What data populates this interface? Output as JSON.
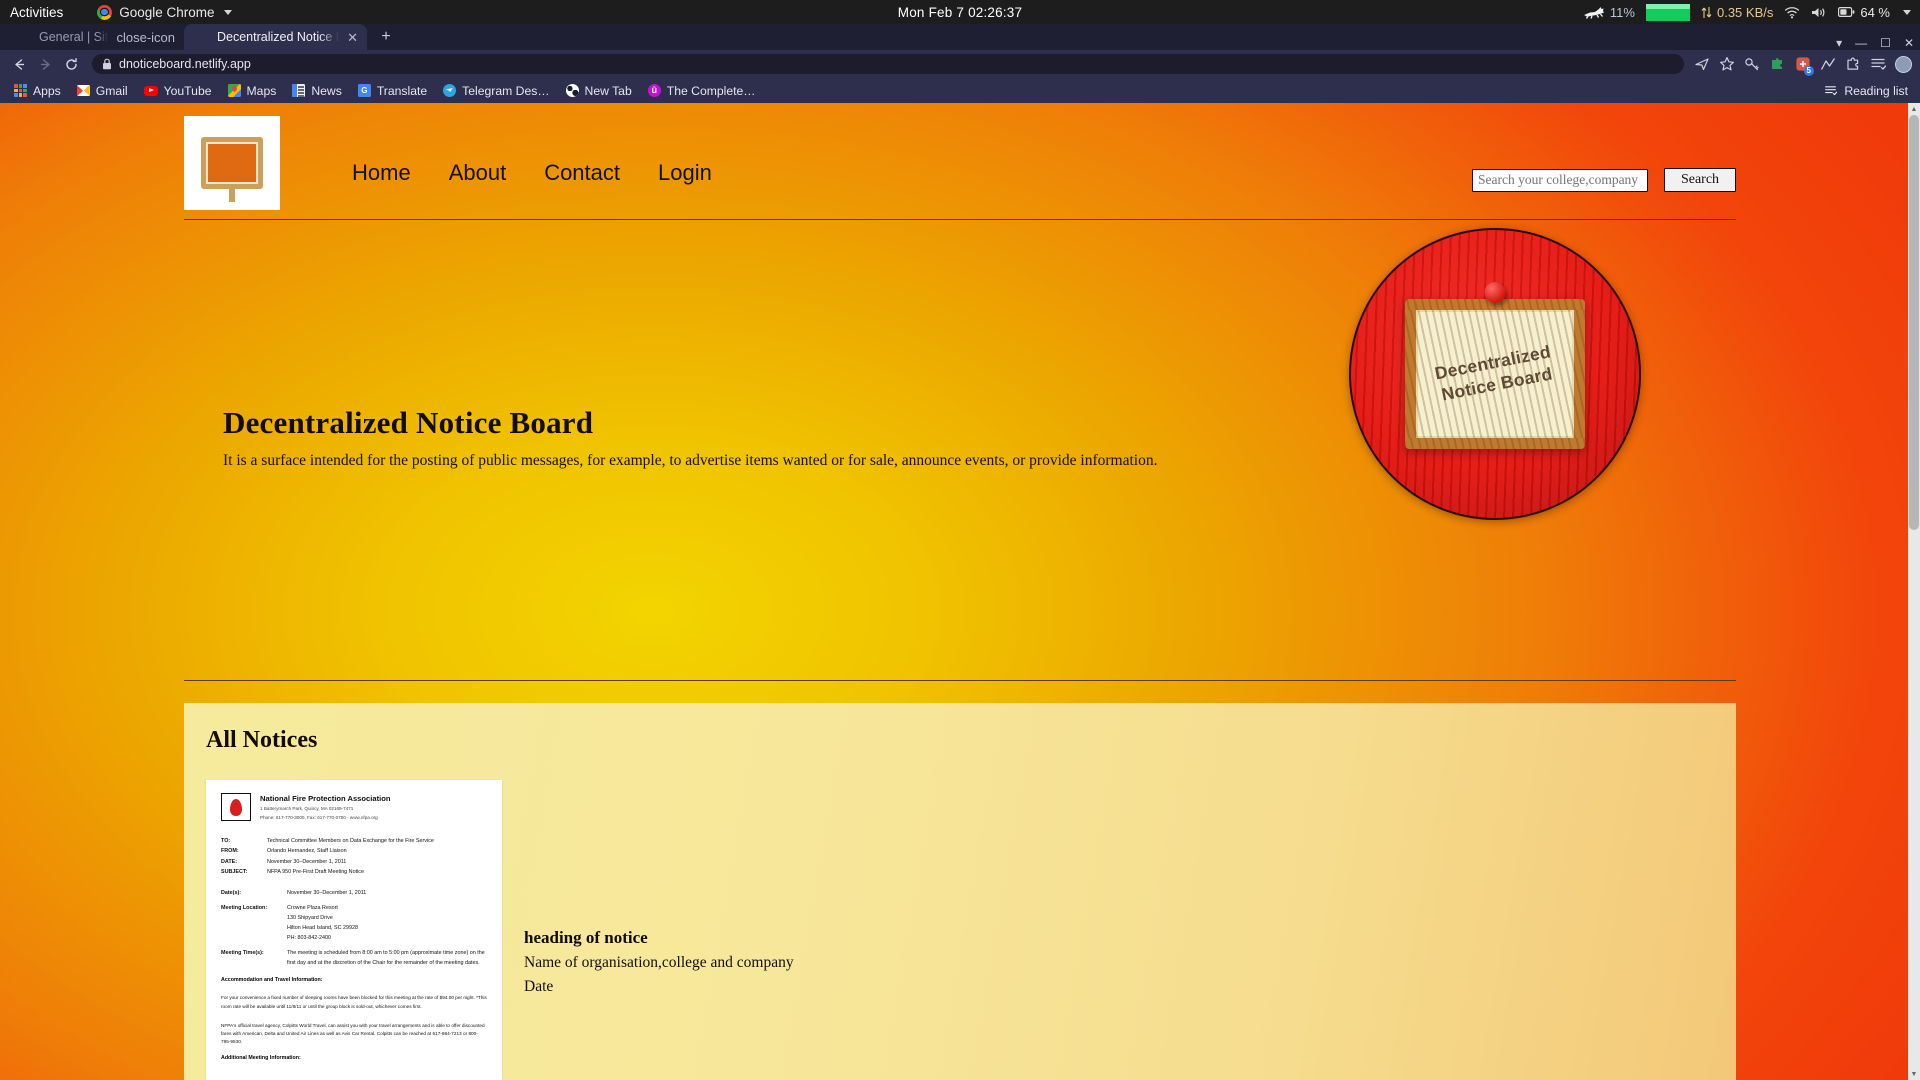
{
  "os_bar": {
    "activities": "Activities",
    "app_name": "Google Chrome",
    "app_menu_icon": "chrome-logo-icon",
    "clock": "Mon Feb 7  02:26:37",
    "tray": {
      "cpu_icon": "running-cat-icon",
      "cpu_load": "11%",
      "network_graph_icon": "network-graph-icon",
      "net_transfer_icon": "up-down-arrows-icon",
      "net_speed": "0.35 KB/s",
      "wifi_icon": "wifi-icon",
      "volume_icon": "speaker-icon",
      "battery_icon": "battery-icon",
      "battery_level": "64 %",
      "menu_caret_icon": "chevron-down-icon"
    }
  },
  "browser": {
    "tabs": [
      {
        "title": "General | Site settings",
        "favicon": "diamond-icon",
        "active": false,
        "close_icon": "close-icon"
      },
      {
        "title": "Decentralized Notice Boa",
        "favicon": "globe-icon",
        "active": true,
        "close_icon": "close-icon"
      }
    ],
    "new_tab_label": "+",
    "window_controls": {
      "minimize": "—",
      "maximize": "❐",
      "close": "✕"
    },
    "toolbar": {
      "back_icon": "back-arrow-icon",
      "forward_icon": "forward-arrow-icon",
      "reload_icon": "reload-icon",
      "lock_icon": "lock-icon",
      "url": "dnoticeboard.netlify.app",
      "share_icon": "share-icon",
      "bookmark_star_icon": "star-icon",
      "key_icon": "key-icon",
      "puzzle_green_icon": "extension-green-icon",
      "extension_badge_icon": "extension-badge-icon",
      "extension_badge_count": "5",
      "chart_icon": "analytics-icon",
      "puzzle_icon": "extensions-puzzle-icon",
      "list_icon": "reading-list-icon",
      "profile_icon": "profile-avatar-icon"
    },
    "bookmarks": [
      {
        "label": "Apps",
        "icon": "apps-grid-icon"
      },
      {
        "label": "Gmail",
        "icon": "gmail-icon"
      },
      {
        "label": "YouTube",
        "icon": "youtube-icon"
      },
      {
        "label": "Maps",
        "icon": "google-maps-icon"
      },
      {
        "label": "News",
        "icon": "google-news-icon"
      },
      {
        "label": "Translate",
        "icon": "google-translate-icon"
      },
      {
        "label": "Telegram Des…",
        "icon": "telegram-icon"
      },
      {
        "label": "New Tab",
        "icon": "globe-icon"
      },
      {
        "label": "The Complete…",
        "icon": "udemy-icon"
      }
    ],
    "reading_list": {
      "label": "Reading list",
      "icon": "reading-list-icon"
    }
  },
  "page": {
    "logo_icon": "notice-board-logo-icon",
    "nav": [
      {
        "label": "Home"
      },
      {
        "label": "About"
      },
      {
        "label": "Contact"
      },
      {
        "label": "Login"
      }
    ],
    "search": {
      "placeholder": "Search your college,company a",
      "value": "",
      "button_label": "Search"
    },
    "hero": {
      "title": "Decentralized Notice Board",
      "subtitle": "It is a surface intended for the posting of public messages, for example, to advertise items wanted or for sale, announce events, or provide information.",
      "image_alt": "corkboard-illustration",
      "board_label": "Decentralized\nNotice Board"
    },
    "notices": {
      "section_title": "All Notices",
      "items": [
        {
          "thumbnail": {
            "org_name": "National Fire Protection Association",
            "org_address_line1": "1 Batterymarch Park, Quincy, MA 02169-7471",
            "org_address_line2": "Phone: 617-770-3000, Fax: 617-770-0700 · www.nfpa.org",
            "memo": [
              {
                "key": "TO:",
                "value": "Technical Committee Members on Data Exchange for the Fire Service"
              },
              {
                "key": "FROM:",
                "value": "Orlando Hernandez, Staff Liaison"
              },
              {
                "key": "DATE:",
                "value": "November 30–December 1, 2011"
              },
              {
                "key": "SUBJECT:",
                "value": "NFPA 950 Pre-First Draft Meeting  Notice"
              }
            ],
            "details": [
              {
                "key": "Date(s):",
                "value": "November 30–December 1, 2011"
              },
              {
                "key": "Meeting Location:",
                "value": "Crowne Plaza Resort\n130 Shipyard Drive\nHilton Head Island, SC 29928\nPH: 803-842-2400"
              },
              {
                "key": "Meeting Time(s):",
                "value": "The meeting is scheduled from 8:00 am to 5:00 pm (approximate time zone) on the first day and at the discretion of the Chair for the remainder of the meeting dates."
              }
            ],
            "accommodation_heading": "Accommodation and Travel Information:",
            "accommodation_text": "For your convenience a fixed number of sleeping rooms have been blocked for this meeting at the rate of $94.00 per night. *This room rate will be available until 11/8/11 or until the group block is sold-out, whichever comes first.",
            "travel_text": "NFPA's official travel agency, Colpitts World Travel, can assist you with your travel arrangements and is able to offer discounted fares with American, Delta and United Air Lines as well as Avis Car Rental. Colpitts can be reached at 617-984-7213 or 800-795-9530.",
            "additional_heading": "Additional Meeting Information:"
          },
          "heading": "heading of notice",
          "organisation": "Name of organisation,college and company",
          "date": "Date"
        }
      ]
    }
  },
  "scrollbar": {
    "up_icon": "scroll-up-icon",
    "down_icon": "scroll-down-icon",
    "thumb": "scroll-thumb"
  },
  "colors": {
    "page_accent_yellow": "#f0c400",
    "page_accent_orange": "#ef7d08",
    "page_accent_red": "#f2450b",
    "notice_panel": "#f6ea9d",
    "chrome_chrome": "#2e2e4d",
    "gnome_bar": "#1d1d1d",
    "net_green": "#13cc5e"
  }
}
